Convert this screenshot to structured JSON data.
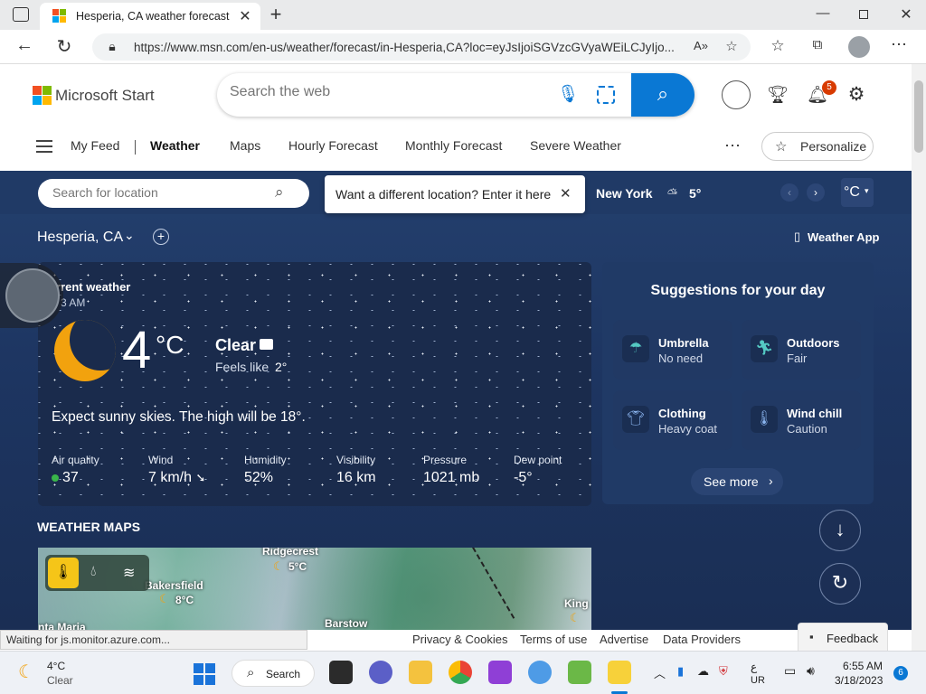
{
  "browser": {
    "tab_title": "Hesperia, CA weather forecast | M",
    "url": "https://www.msn.com/en-us/weather/forecast/in-Hesperia,CA?loc=eyJsIjoiSGVzcGVyaWEiLCJyIjo..."
  },
  "header": {
    "brand": "Microsoft Start",
    "search_placeholder": "Search the web",
    "notification_count": "5",
    "nav": [
      "My Feed",
      "Weather",
      "Maps",
      "Hourly Forecast",
      "Monthly Forecast",
      "Severe Weather"
    ],
    "personalize": "Personalize"
  },
  "locbar": {
    "placeholder": "Search for location",
    "tooltip": "Want a different location? Enter it here",
    "other_city": "New York",
    "other_temp": "5°",
    "unit": "°C"
  },
  "location": {
    "name": "Hesperia, CA",
    "weather_app": "Weather App"
  },
  "current": {
    "heading": "rrent weather",
    "time": "3 AM",
    "temp": "4",
    "unit": "°C",
    "condition": "Clear",
    "feels_label": "Feels like",
    "feels_value": "2°",
    "summary": "Expect sunny skies. The high will be 18°.",
    "stats": [
      {
        "label": "Air quality",
        "value": "37"
      },
      {
        "label": "Wind",
        "value": "7 km/h"
      },
      {
        "label": "Humidity",
        "value": "52%"
      },
      {
        "label": "Visibility",
        "value": "16 km"
      },
      {
        "label": "Pressure",
        "value": "1021 mb"
      },
      {
        "label": "Dew point",
        "value": "-5°"
      }
    ]
  },
  "suggestions": {
    "title": "Suggestions for your day",
    "items": [
      {
        "title": "Umbrella",
        "sub": "No need"
      },
      {
        "title": "Outdoors",
        "sub": "Fair"
      },
      {
        "title": "Clothing",
        "sub": "Heavy coat"
      },
      {
        "title": "Wind chill",
        "sub": "Caution"
      }
    ],
    "see_more": "See more"
  },
  "maps": {
    "title": "WEATHER MAPS",
    "cities": [
      {
        "name": "Ridgecrest",
        "temp": "5°C"
      },
      {
        "name": "Bakersfield",
        "temp": "8°C"
      },
      {
        "name": "Barstow"
      },
      {
        "name": "King"
      },
      {
        "name": "nta Maria"
      }
    ]
  },
  "footer": {
    "status": "Waiting for js.monitor.azure.com...",
    "links": [
      "Privacy & Cookies",
      "Terms of use",
      "Advertise",
      "Data Providers"
    ],
    "feedback": "Feedback"
  },
  "taskbar": {
    "weather_temp": "4°C",
    "weather_cond": "Clear",
    "search": "Search",
    "lang_top": "ع",
    "lang_bottom": "UR",
    "time": "6:55 AM",
    "date": "3/18/2023",
    "notif": "6"
  }
}
